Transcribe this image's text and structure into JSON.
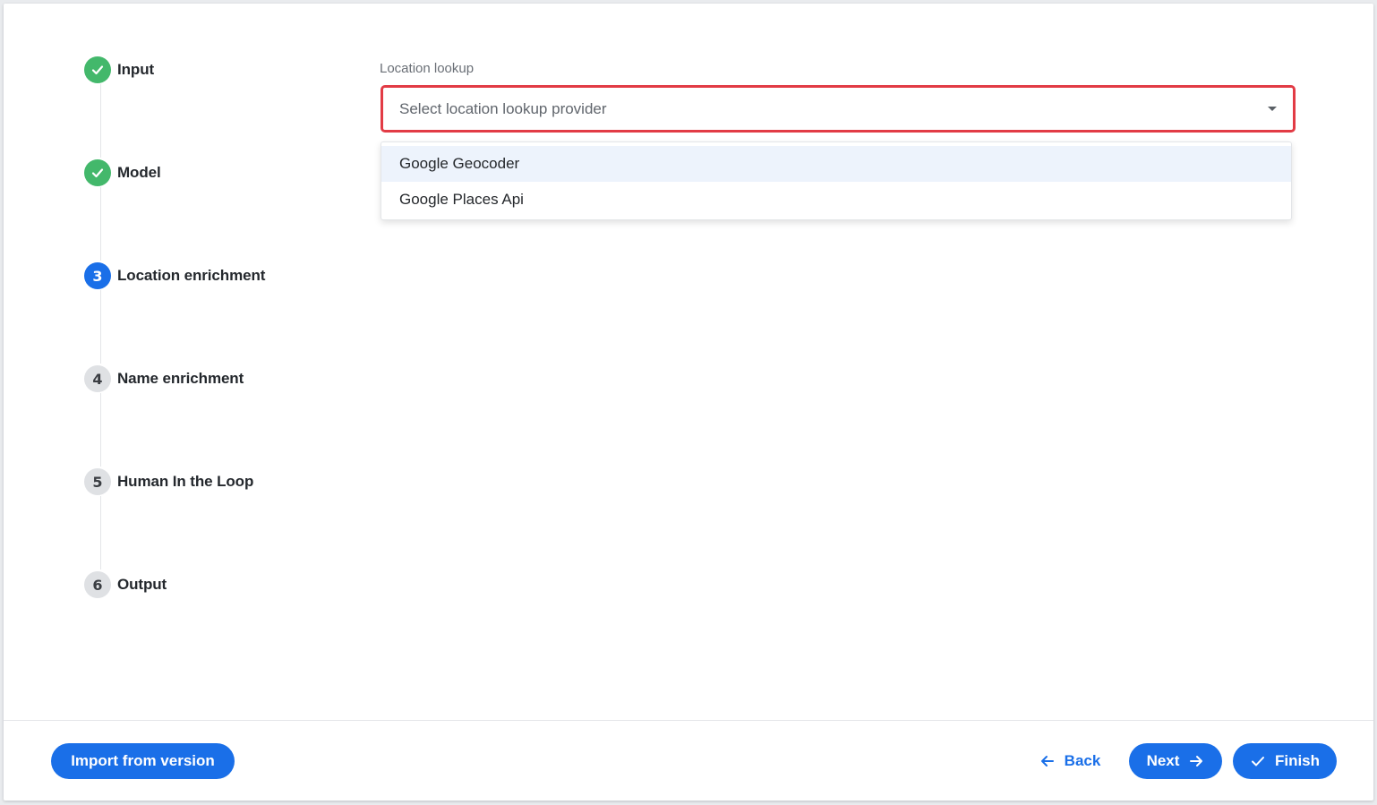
{
  "stepper": {
    "steps": [
      {
        "label": "Input",
        "state": "done",
        "badge": ""
      },
      {
        "label": "Model",
        "state": "done",
        "badge": ""
      },
      {
        "label": "Location enrichment",
        "state": "active",
        "badge": "3"
      },
      {
        "label": "Name enrichment",
        "state": "pending",
        "badge": "4"
      },
      {
        "label": "Human In the Loop",
        "state": "pending",
        "badge": "5"
      },
      {
        "label": "Output",
        "state": "pending",
        "badge": "6"
      }
    ]
  },
  "form": {
    "location_lookup_label": "Location lookup",
    "select_placeholder": "Select location lookup provider",
    "options": [
      "Google Geocoder",
      "Google Places Api"
    ]
  },
  "footer": {
    "import_label": "Import from version",
    "back_label": "Back",
    "next_label": "Next",
    "finish_label": "Finish"
  },
  "colors": {
    "primary": "#1a6fe8",
    "done": "#43b86b",
    "error_border": "#e23b45"
  }
}
